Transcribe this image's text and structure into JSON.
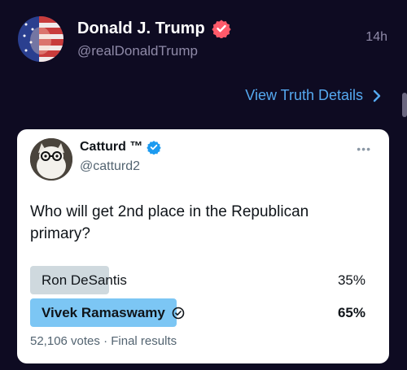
{
  "post": {
    "display_name": "Donald J. Trump",
    "handle": "@realDonaldTrump",
    "timestamp": "14h",
    "details_link": "View Truth Details",
    "avatar_icon": "user-avatar-icon"
  },
  "tweet": {
    "name": "Catturd ™",
    "handle": "@catturd2",
    "text": "Who will get 2nd place in the Republican primary?",
    "poll": {
      "options": [
        {
          "label": "Ron DeSantis",
          "percent": "35%",
          "fraction": 0.35,
          "winner": false
        },
        {
          "label": "Vivek Ramaswamy",
          "percent": "65%",
          "fraction": 0.65,
          "winner": true
        }
      ],
      "votes": "52,106 votes",
      "separator": "·",
      "status": "Final results"
    }
  },
  "colors": {
    "background": "#0e0b22",
    "link": "#55a9f0",
    "truth_badge": "#ff5a6a",
    "twitter_blue": "#1d9bf0",
    "poll_winner": "#7cc6f4",
    "poll_other": "#cfd9de"
  }
}
